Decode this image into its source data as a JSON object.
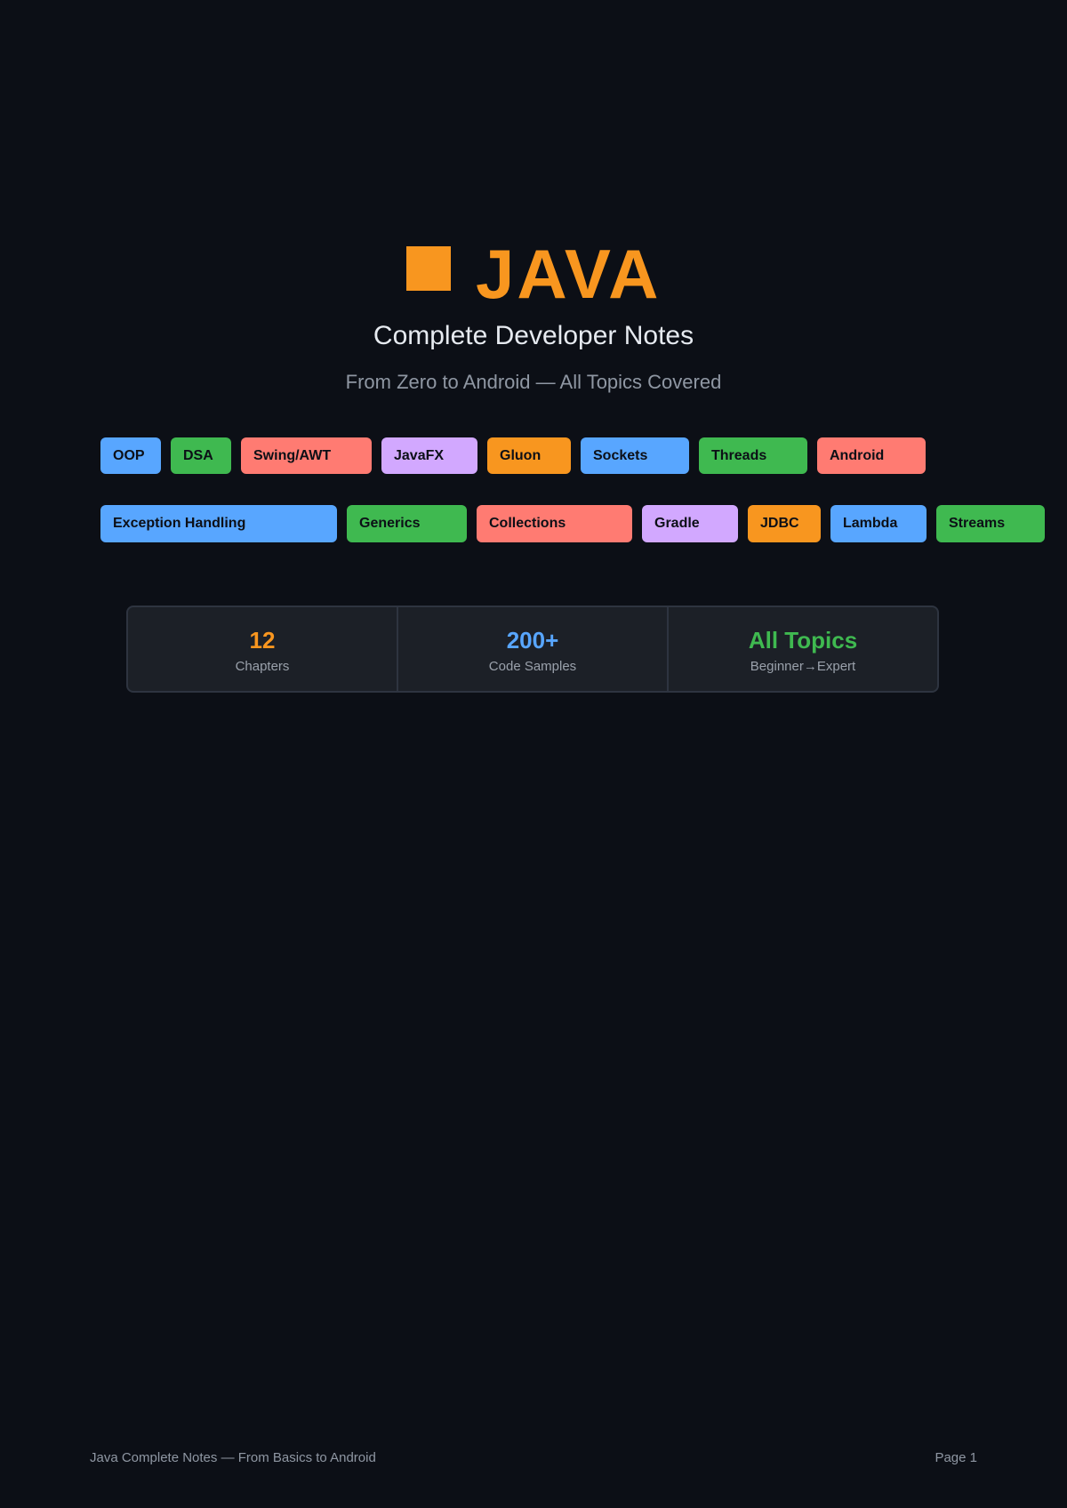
{
  "cover": {
    "title": "JAVA",
    "title_icon": "orange-square-icon",
    "subtitle": "Complete Developer Notes",
    "tagline": "From Zero to Android — All Topics Covered"
  },
  "colors": {
    "accent": "#f8961f",
    "blue": "#58a6ff",
    "green": "#3fb950",
    "red": "#ff7b72",
    "purple": "#d2a8ff",
    "background": "#0c0f16"
  },
  "tags_row1": [
    {
      "label": "OOP",
      "color": "#58a6ff"
    },
    {
      "label": "DSA",
      "color": "#3fb950"
    },
    {
      "label": "Swing/AWT",
      "color": "#ff7b72"
    },
    {
      "label": "JavaFX",
      "color": "#d2a8ff"
    },
    {
      "label": "Gluon",
      "color": "#f8961f"
    },
    {
      "label": "Sockets",
      "color": "#58a6ff"
    },
    {
      "label": "Threads",
      "color": "#3fb950"
    },
    {
      "label": "Android",
      "color": "#ff7b72"
    }
  ],
  "tags_row2": [
    {
      "label": "Exception Handling",
      "color": "#58a6ff"
    },
    {
      "label": "Generics",
      "color": "#3fb950"
    },
    {
      "label": "Collections",
      "color": "#ff7b72"
    },
    {
      "label": "Gradle",
      "color": "#d2a8ff"
    },
    {
      "label": "JDBC",
      "color": "#f8961f"
    },
    {
      "label": "Lambda",
      "color": "#58a6ff"
    },
    {
      "label": "Streams",
      "color": "#3fb950"
    }
  ],
  "stats": [
    {
      "value": "12",
      "label": "Chapters",
      "color": "#f8961f"
    },
    {
      "value": "200+",
      "label": "Code Samples",
      "color": "#58a6ff"
    },
    {
      "value": "All Topics",
      "label": "Beginner→Expert",
      "color": "#3fb950"
    }
  ],
  "footer": {
    "left": "Java Complete Notes — From Basics to Android",
    "right": "Page 1"
  }
}
